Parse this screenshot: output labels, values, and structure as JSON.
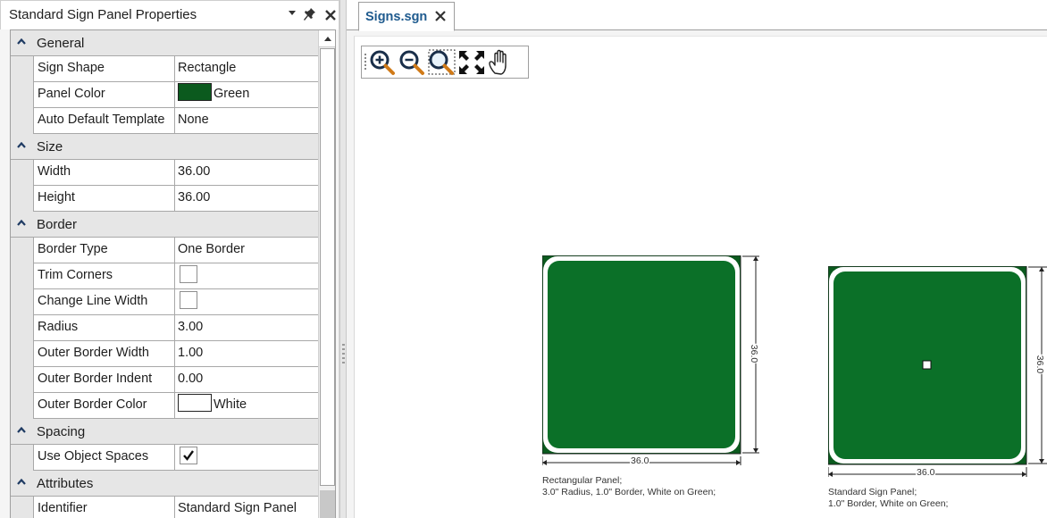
{
  "panel": {
    "title": "Standard Sign Panel Properties",
    "buttons": {
      "dropdown": "▾",
      "pin": "📌",
      "close": "✕"
    }
  },
  "grid": {
    "categories": [
      {
        "label": "General",
        "toggle": "^",
        "props": [
          {
            "name": "Sign Shape",
            "value": "Rectangle",
            "type": "text"
          },
          {
            "name": "Panel Color",
            "value": "Green",
            "type": "color",
            "color": "#0b5a1e"
          },
          {
            "name": "Auto Default Template",
            "value": "None",
            "type": "text"
          }
        ]
      },
      {
        "label": "Size",
        "toggle": "^",
        "props": [
          {
            "name": "Width",
            "value": "36.00",
            "type": "text"
          },
          {
            "name": "Height",
            "value": "36.00",
            "type": "text"
          }
        ]
      },
      {
        "label": "Border",
        "toggle": "^",
        "props": [
          {
            "name": "Border Type",
            "value": "One Border",
            "type": "text"
          },
          {
            "name": "Trim Corners",
            "value": "",
            "type": "checkbox",
            "checked": false
          },
          {
            "name": "Change Line Width",
            "value": "",
            "type": "checkbox",
            "checked": false
          },
          {
            "name": "Radius",
            "value": "3.00",
            "type": "text"
          },
          {
            "name": "Outer Border Width",
            "value": "1.00",
            "type": "text"
          },
          {
            "name": "Outer Border Indent",
            "value": "0.00",
            "type": "text"
          },
          {
            "name": "Outer Border Color",
            "value": "White",
            "type": "color",
            "color": "#ffffff"
          }
        ]
      },
      {
        "label": "Spacing",
        "toggle": "^",
        "props": [
          {
            "name": "Use Object Spaces",
            "value": "",
            "type": "checkbox",
            "checked": true
          }
        ]
      },
      {
        "label": "Attributes",
        "toggle": "^",
        "props": [
          {
            "name": "Identifier",
            "value": "Standard Sign Panel",
            "type": "text"
          }
        ]
      }
    ]
  },
  "document": {
    "tab_label": "Signs.sgn",
    "tab_close": "✕",
    "toolbar": [
      "zoom-in",
      "zoom-out",
      "zoom-window",
      "zoom-extents",
      "pan"
    ]
  },
  "signs": [
    {
      "width_label": "36.0",
      "height_label": "36.0",
      "caption_line1": "Rectangular Panel;",
      "caption_line2": "3.0\" Radius, 1.0\" Border, White on Green;",
      "panel_color": "#0b7028",
      "corner_color": "#0b5a1e",
      "border_color": "#ffffff",
      "selected": false
    },
    {
      "width_label": "36.0",
      "height_label": "36.0",
      "caption_line1": "Standard Sign Panel;",
      "caption_line2": "1.0\" Border, White on Green;",
      "panel_color": "#0b7028",
      "corner_color": "#0b5a1e",
      "border_color": "#ffffff",
      "selected": true
    }
  ]
}
